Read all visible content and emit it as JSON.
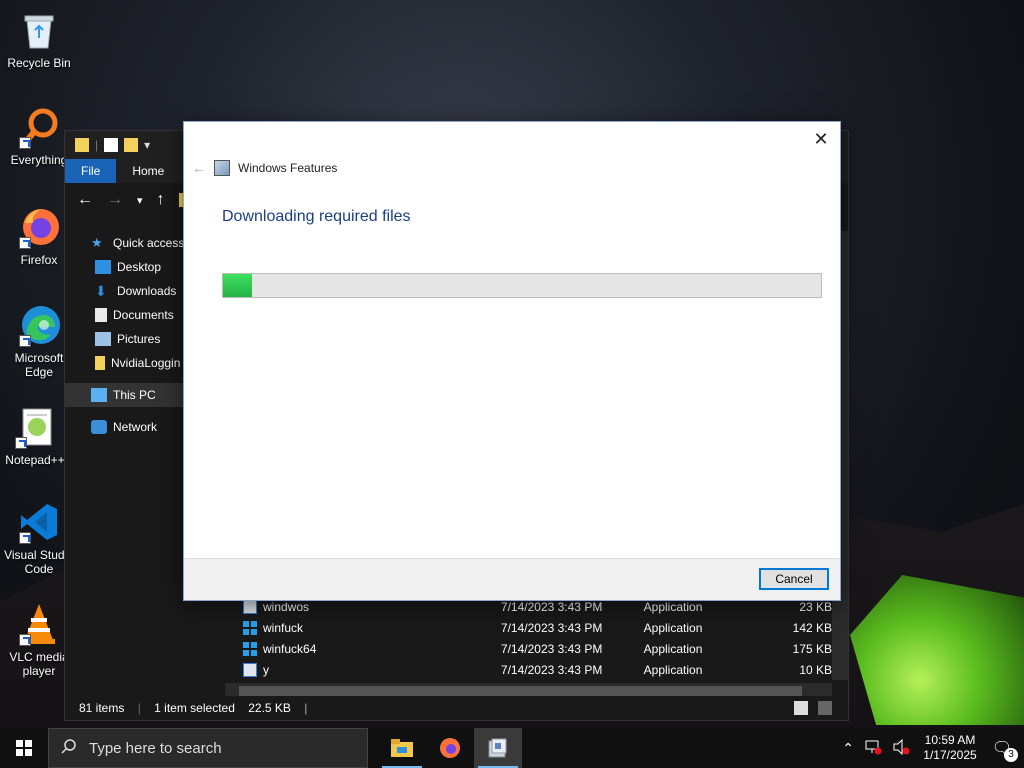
{
  "desktop": {
    "icons": [
      {
        "label": "Recycle Bin",
        "icon": "recycle-bin-icon"
      },
      {
        "label": "Everything",
        "icon": "everything-search-icon"
      },
      {
        "label": "Firefox",
        "icon": "firefox-icon"
      },
      {
        "label": "Microsoft Edge",
        "icon": "edge-icon"
      },
      {
        "label": "Notepad++",
        "icon": "notepad-plus-plus-icon"
      },
      {
        "label": "Visual Studio Code",
        "icon": "vscode-icon"
      },
      {
        "label": "VLC media player",
        "icon": "vlc-icon"
      }
    ]
  },
  "explorer": {
    "ribbon_tabs": [
      "File",
      "Home"
    ],
    "sidebar": [
      {
        "label": "Quick access",
        "icon": "star-icon"
      },
      {
        "label": "Desktop",
        "icon": "desktop-folder-icon"
      },
      {
        "label": "Downloads",
        "icon": "downloads-icon"
      },
      {
        "label": "Documents",
        "icon": "documents-icon"
      },
      {
        "label": "Pictures",
        "icon": "pictures-icon"
      },
      {
        "label": "NvidiaLoggin",
        "icon": "folder-icon"
      },
      {
        "label": "This PC",
        "icon": "this-pc-icon"
      },
      {
        "label": "Network",
        "icon": "network-icon"
      }
    ],
    "files": [
      {
        "name": "windwos",
        "date": "7/14/2023 3:43 PM",
        "type": "Application",
        "size": "23 KB"
      },
      {
        "name": "winfuck",
        "date": "7/14/2023 3:43 PM",
        "type": "Application",
        "size": "142 KB"
      },
      {
        "name": "winfuck64",
        "date": "7/14/2023 3:43 PM",
        "type": "Application",
        "size": "175 KB"
      },
      {
        "name": "y",
        "date": "7/14/2023 3:43 PM",
        "type": "Application",
        "size": "10 KB"
      }
    ],
    "status": {
      "items": "81 items",
      "selected": "1 item selected",
      "size": "22.5 KB"
    }
  },
  "dialog": {
    "title": "Windows Features",
    "heading": "Downloading required files",
    "progress": 0.048,
    "cancel_label": "Cancel",
    "close_glyph": "✕"
  },
  "taskbar": {
    "search_placeholder": "Type here to search",
    "apps": [
      "file-explorer-icon",
      "firefox-icon",
      "windows-features-icon"
    ],
    "time": "10:59 AM",
    "date": "1/17/2025",
    "notification_count": "3"
  }
}
